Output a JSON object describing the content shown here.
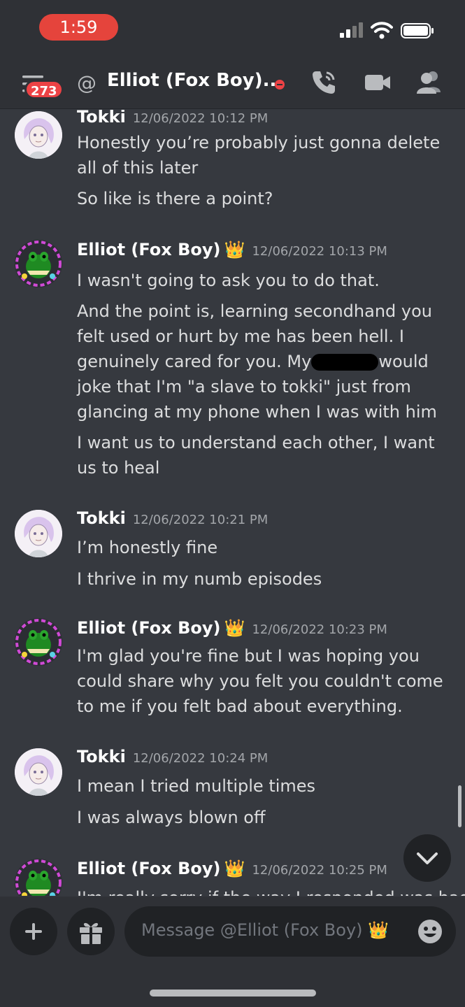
{
  "status_bar": {
    "time": "1:59"
  },
  "header": {
    "badge_count": "273",
    "at_symbol": "@",
    "channel_title": "Elliot (Fox Boy)...",
    "status": "do-not-disturb"
  },
  "messages": [
    {
      "author": "Tokki",
      "crown": "",
      "timestamp": "12/06/2022 10:12 PM",
      "lines": [
        "Honestly you’re probably just gonna delete all of this later",
        "So like is there a point?"
      ]
    },
    {
      "author": "Elliot (Fox Boy)",
      "crown": "👑",
      "timestamp": "12/06/2022 10:13 PM",
      "lines": [
        "I wasn't going to ask you to do that.",
        "And the point is, learning secondhand you felt used or hurt by me has been hell. I genuinely cared for you. My",
        "would joke that I'm \"a slave to tokki\" just from glancing at my phone when I was with him",
        "I want us to understand each other, I want us to heal"
      ]
    },
    {
      "author": "Tokki",
      "crown": "",
      "timestamp": "12/06/2022 10:21 PM",
      "lines": [
        "I’m honestly fine",
        "I thrive in my numb episodes"
      ]
    },
    {
      "author": "Elliot (Fox Boy)",
      "crown": "👑",
      "timestamp": "12/06/2022 10:23 PM",
      "lines": [
        "I'm glad you're fine but I was hoping you could share why you felt you couldn't come to me if you felt bad about everything."
      ]
    },
    {
      "author": "Tokki",
      "crown": "",
      "timestamp": "12/06/2022 10:24 PM",
      "lines": [
        "I mean I tried multiple times",
        "I was always blown off"
      ]
    },
    {
      "author": "Elliot (Fox Boy)",
      "crown": "👑",
      "timestamp": "12/06/2022 10:25 PM",
      "lines": [
        "I'm really sorry if the way I responded was bad"
      ]
    }
  ],
  "composer": {
    "placeholder": "Message @Elliot (Fox Boy) 👑"
  },
  "icons": [
    "menu-icon",
    "call-icon",
    "video-icon",
    "members-icon",
    "plus-icon",
    "gift-icon",
    "emoji-icon",
    "chevron-down-icon"
  ],
  "colors": {
    "background": "#36393f",
    "header": "#2f3136",
    "accent_red": "#ed4245",
    "clock_pill": "#e5443c"
  }
}
